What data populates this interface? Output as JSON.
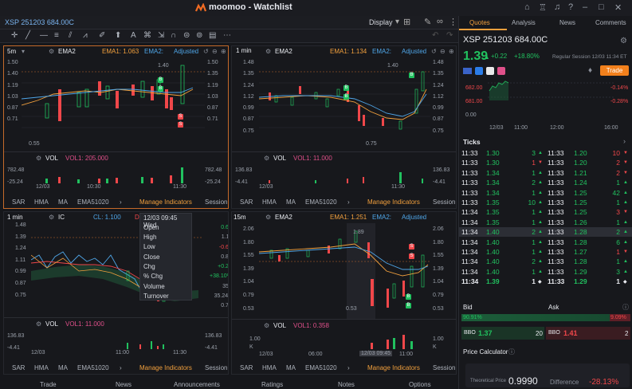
{
  "app": {
    "title": "moomoo - Watchlist"
  },
  "subbar": {
    "symbol": "XSP 251203 684.00C",
    "display": "Display"
  },
  "panes": [
    {
      "interval": "5m",
      "indicator": "EMA2",
      "ema1": "EMA1: 1.063",
      "ema2": "EMA2:",
      "adjust": "Adjusted",
      "yaxis": [
        "1.50",
        "1.40",
        "1.19",
        "1.03",
        "0.87",
        "0.71",
        "0.55"
      ],
      "yaxis_right": [
        "1.50",
        "1.35",
        "1.19",
        "1.03",
        "0.87",
        "0.71",
        "0.55"
      ],
      "hi": "1.40",
      "lo": "0.55",
      "x": [
        "12/03",
        "10:30",
        "11:30"
      ],
      "vol_label": "VOL",
      "vol_value": "VOL1: 205.000",
      "vol_axis": [
        "782.48",
        "-25.24"
      ],
      "vol_axis_right": [
        "782.48",
        "-25.24"
      ],
      "tabs": [
        "SAR",
        "HMA",
        "MA",
        "EMA51020"
      ],
      "manage": "Manage Indicators",
      "session": "Session"
    },
    {
      "interval": "1 min",
      "indicator": "EMA2",
      "ema1": "EMA1: 1.134",
      "ema2": "EMA2:",
      "adjust": "Adjusted",
      "yaxis": [
        "1.48",
        "1.35",
        "1.24",
        "1.12",
        "0.99",
        "0.87",
        "0.75"
      ],
      "yaxis_right": [
        "1.48",
        "1.35",
        "1.24",
        "1.12",
        "0.99",
        "0.87",
        "0.75"
      ],
      "hi": "1.40",
      "lo": "0.75",
      "x": [
        "12/03",
        "11:30"
      ],
      "vol_label": "VOL",
      "vol_value": "VOL1: 11.000",
      "vol_axis": [
        "136.83",
        "-4.41"
      ],
      "vol_axis_right": [
        "136.83",
        "-4.41"
      ],
      "tabs": [
        "SAR",
        "HMA",
        "MA",
        "EMA51020"
      ],
      "manage": "Manage Indicators",
      "session": "Session"
    },
    {
      "interval": "1 min",
      "indicator": "IC",
      "ema1": "CL: 1.100",
      "ema2": "DL",
      "yaxis": [
        "1.48",
        "1.39",
        "1.24",
        "1.11",
        "0.99",
        "0.87",
        "0.75"
      ],
      "yaxis_right": [
        "0.69",
        "1.11",
        "-0.67",
        "0.87",
        "+0.24",
        "+38.10%",
        "358",
        "35.24K",
        "0.75"
      ],
      "x": [
        "12/03",
        "11:00",
        "11:30"
      ],
      "vol_label": "VOL",
      "vol_value": "VOL1: 11.000",
      "vol_axis": [
        "136.83",
        "-4.41"
      ],
      "vol_axis_right": [
        "136.83",
        "-4.41"
      ],
      "tabs": [
        "SAR",
        "HMA",
        "MA",
        "EMA51020"
      ],
      "manage": "Manage Indicators",
      "session": "Session"
    },
    {
      "interval": "15m",
      "indicator": "EMA2",
      "ema1": "EMA1: 1.251",
      "ema2": "EMA2:",
      "adjust": "Adjusted",
      "yaxis": [
        "2.06",
        "1.80",
        "1.55",
        "1.39",
        "1.04",
        "0.79",
        "0.53"
      ],
      "yaxis_right": [
        "2.06",
        "1.80",
        "1.55",
        "1.39",
        "1.04",
        "0.79",
        "0.53"
      ],
      "hi": "1.89",
      "lo": "0.53",
      "x": [
        "12/03",
        "06:00",
        "11:00"
      ],
      "crosshair_time": "12/03 09:45",
      "vol_label": "VOL",
      "vol_value": "VOL1: 0.358",
      "vol_axis": [
        "1.00",
        "K"
      ],
      "vol_axis_right": [
        "1.00",
        "K"
      ],
      "tabs": [
        "SAR",
        "HMA",
        "MA",
        "EMA51020"
      ],
      "manage": "Manage Indicators",
      "session": "Session"
    }
  ],
  "context_menu": {
    "header": "12/03 09:45 Wed",
    "items": [
      "Open",
      "High",
      "Low",
      "Close",
      "Chg",
      "% Chg",
      "Volume",
      "Turnover"
    ]
  },
  "bottombar": [
    "Trade",
    "News",
    "Announcements",
    "Ratings",
    "Notes",
    "Options"
  ],
  "right": {
    "tabs": [
      "Quotes",
      "Analysis",
      "News",
      "Comments"
    ],
    "symbol": "XSP 251203 684.00C",
    "price": "1.39",
    "change": "+0.22",
    "change_pct": "+18.80%",
    "session": "Regular Session 12/03 11:34 ET",
    "trade_btn": "Trade",
    "mini_y": [
      "682.00",
      "681.00",
      "0.00"
    ],
    "mini_y_right": [
      "-0.14%",
      "-0.28%"
    ],
    "mini_x": [
      "12/03",
      "11:00",
      "12:00",
      "16:00"
    ],
    "ticks_label": "Ticks",
    "ticks": [
      {
        "t": "11:33",
        "p": "1.30",
        "v": "3",
        "d": "up",
        "t2": "11:33",
        "p2": "1.20",
        "v2": "10",
        "d2": "down"
      },
      {
        "t": "11:33",
        "p": "1.30",
        "v": "1",
        "d": "down",
        "t2": "11:33",
        "p2": "1.20",
        "v2": "2",
        "d2": "down"
      },
      {
        "t": "11:33",
        "p": "1.34",
        "v": "1",
        "d": "up",
        "t2": "11:33",
        "p2": "1.21",
        "v2": "2",
        "d2": "down"
      },
      {
        "t": "11:33",
        "p": "1.34",
        "v": "2",
        "d": "up",
        "t2": "11:33",
        "p2": "1.24",
        "v2": "1",
        "d2": "up"
      },
      {
        "t": "11:33",
        "p": "1.34",
        "v": "1",
        "d": "up",
        "t2": "11:33",
        "p2": "1.25",
        "v2": "42",
        "d2": "up"
      },
      {
        "t": "11:33",
        "p": "1.35",
        "v": "10",
        "d": "up",
        "t2": "11:33",
        "p2": "1.25",
        "v2": "1",
        "d2": "up"
      },
      {
        "t": "11:34",
        "p": "1.35",
        "v": "1",
        "d": "up",
        "t2": "11:33",
        "p2": "1.25",
        "v2": "3",
        "d2": "down"
      },
      {
        "t": "11:34",
        "p": "1.35",
        "v": "1",
        "d": "up",
        "t2": "11:33",
        "p2": "1.26",
        "v2": "1",
        "d2": "up"
      },
      {
        "t": "11:34",
        "p": "1.40",
        "v": "2",
        "d": "up",
        "t2": "11:33",
        "p2": "1.28",
        "v2": "2",
        "d2": "up"
      },
      {
        "t": "11:34",
        "p": "1.40",
        "v": "1",
        "d": "up",
        "t2": "11:33",
        "p2": "1.28",
        "v2": "6",
        "d2": "up"
      },
      {
        "t": "11:34",
        "p": "1.40",
        "v": "1",
        "d": "up",
        "t2": "11:33",
        "p2": "1.27",
        "v2": "1",
        "d2": "down"
      },
      {
        "t": "11:34",
        "p": "1.40",
        "v": "2",
        "d": "up",
        "t2": "11:33",
        "p2": "1.28",
        "v2": "1",
        "d2": "up"
      },
      {
        "t": "11:34",
        "p": "1.40",
        "v": "1",
        "d": "up",
        "t2": "11:33",
        "p2": "1.29",
        "v2": "3",
        "d2": "up"
      },
      {
        "t": "11:34",
        "p": "1.39",
        "v": "1",
        "d": "none",
        "t2": "11:33",
        "p2": "1.29",
        "v2": "1",
        "d2": "none"
      }
    ],
    "bid_label": "Bid",
    "ask_label": "Ask",
    "bid_pct": "90.91%",
    "ask_pct": "9.09%",
    "bbo_bid_label": "BBO",
    "bbo_bid": "1.37",
    "bbo_bid_size": "20",
    "bbo_ask_label": "BBO",
    "bbo_ask": "1.41",
    "bbo_ask_size": "2",
    "calc_label": "Price Calculator",
    "theo_label": "Theoretical Price",
    "theo_value": "0.9990",
    "diff_label": "Difference",
    "diff_value": "-28.13%"
  },
  "colors": {
    "up": "#21c15f",
    "down": "#f0474a",
    "accent": "#f2a03d",
    "bg": "#16171b"
  }
}
